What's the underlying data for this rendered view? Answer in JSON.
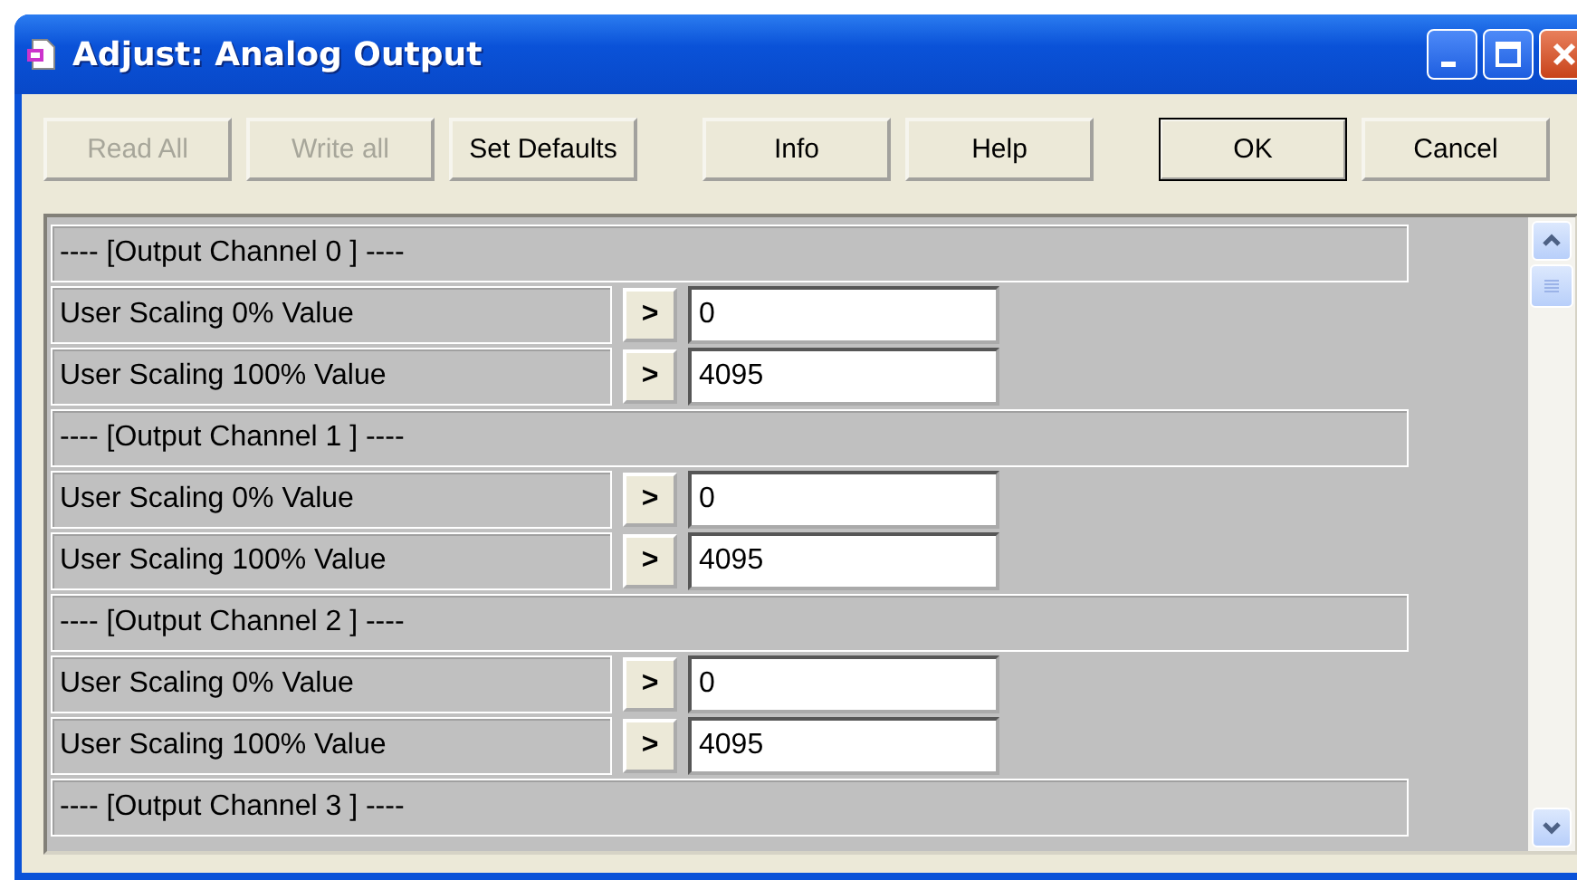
{
  "window": {
    "title": "Adjust: Analog Output"
  },
  "toolbar": [
    {
      "buttons": [
        {
          "label": "Read All",
          "disabled": true,
          "default": false
        },
        {
          "label": "Write all",
          "disabled": true,
          "default": false
        },
        {
          "label": "Set Defaults",
          "disabled": false,
          "default": false
        }
      ]
    },
    {
      "buttons": [
        {
          "label": "Info",
          "disabled": false,
          "default": false
        },
        {
          "label": "Help",
          "disabled": false,
          "default": false
        }
      ]
    },
    {
      "buttons": [
        {
          "label": "OK",
          "disabled": false,
          "default": true
        },
        {
          "label": "Cancel",
          "disabled": false,
          "default": false
        }
      ]
    }
  ],
  "channels": [
    {
      "header": "---- [Output Channel 0 ] ----",
      "params": [
        {
          "label": "User Scaling 0% Value",
          "button": ">",
          "value": "0"
        },
        {
          "label": "User Scaling 100% Value",
          "button": ">",
          "value": "4095"
        }
      ]
    },
    {
      "header": "---- [Output Channel 1 ] ----",
      "params": [
        {
          "label": "User Scaling 0% Value",
          "button": ">",
          "value": "0"
        },
        {
          "label": "User Scaling 100% Value",
          "button": ">",
          "value": "4095"
        }
      ]
    },
    {
      "header": "---- [Output Channel 2 ] ----",
      "params": [
        {
          "label": "User Scaling 0% Value",
          "button": ">",
          "value": "0"
        },
        {
          "label": "User Scaling 100% Value",
          "button": ">",
          "value": "4095"
        }
      ]
    },
    {
      "header": "---- [Output Channel 3 ] ----"
    }
  ]
}
